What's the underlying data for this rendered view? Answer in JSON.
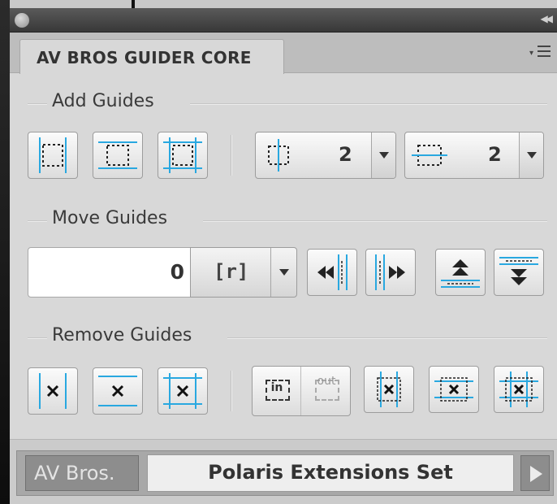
{
  "panel": {
    "title": "AV BROS GUIDER CORE"
  },
  "sections": {
    "add": "Add Guides",
    "move": "Move Guides",
    "remove": "Remove Guides"
  },
  "add_guides": {
    "vertical_count": "2",
    "horizontal_count": "2"
  },
  "move_guides": {
    "offset_value": "0",
    "unit": "[r]"
  },
  "remove_guides": {
    "in_label": "in",
    "out_label": "out"
  },
  "footer": {
    "brand": "AV Bros.",
    "set_name": "Polaris Extensions Set"
  },
  "colors": {
    "accent": "#29a8e0",
    "panel_bg": "#d8d8d8"
  }
}
